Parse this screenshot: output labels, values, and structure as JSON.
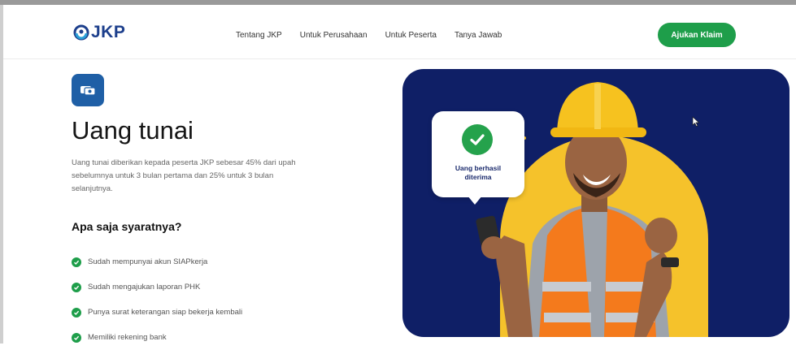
{
  "header": {
    "logo_text": "JKP",
    "nav": [
      "Tentang JKP",
      "Untuk Perusahaan",
      "Untuk Peserta",
      "Tanya Jawab"
    ],
    "cta_label": "Ajukan Klaim"
  },
  "main": {
    "title": "Uang tunai",
    "description": "Uang tunai diberikan kepada peserta JKP sebesar 45% dari upah sebelumnya untuk 3 bulan pertama dan 25% untuk 3 bulan selanjutnya.",
    "requirements_heading": "Apa saja syaratnya?",
    "requirements": [
      "Sudah mempunyai akun SIAPkerja",
      "Sudah mengajukan laporan PHK",
      "Punya surat keterangan siap bekerja kembali",
      "Memiliki rekening bank"
    ]
  },
  "hero": {
    "bubble_text_line1": "Uang berhasil",
    "bubble_text_line2": "diterima"
  },
  "colors": {
    "brand_blue": "#1d3f8c",
    "cta_green": "#1e9e4a",
    "hero_navy": "#0f1f66",
    "hero_yellow": "#f5c22b"
  }
}
